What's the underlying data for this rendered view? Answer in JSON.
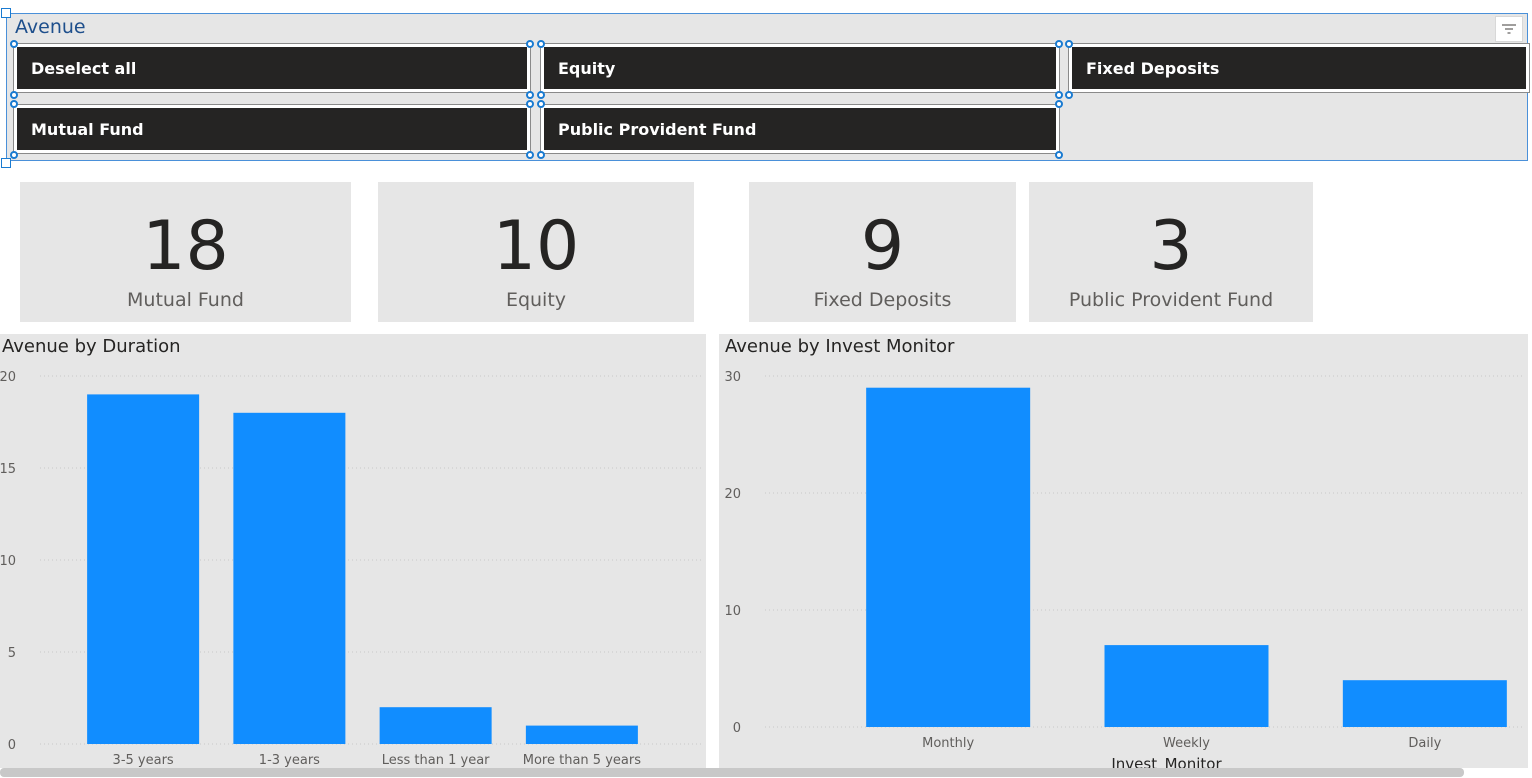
{
  "slicer": {
    "title": "Avenue",
    "filter_icon": "filter-lines-icon",
    "options": [
      {
        "label": "Deselect all"
      },
      {
        "label": "Equity"
      },
      {
        "label": "Fixed Deposits"
      },
      {
        "label": "Mutual Fund"
      },
      {
        "label": "Public Provident Fund"
      }
    ]
  },
  "cards": [
    {
      "value": "18",
      "label": "Mutual Fund"
    },
    {
      "value": "10",
      "label": "Equity"
    },
    {
      "value": "9",
      "label": "Fixed Deposits"
    },
    {
      "value": "3",
      "label": "Public Provident Fund"
    }
  ],
  "colors": {
    "bar": "#118dff",
    "panel": "#e6e6e6",
    "chip": "#252423",
    "selection": "#1a7bd1"
  },
  "chart_data": [
    {
      "type": "bar",
      "title": "Avenue by Duration",
      "categories": [
        "3-5 years",
        "1-3 years",
        "Less than 1 year",
        "More than 5 years"
      ],
      "values": [
        19,
        18,
        2,
        1
      ],
      "yticks": [
        "0",
        "5",
        "10",
        "15",
        "20"
      ],
      "ylim": [
        0,
        20
      ],
      "xlabel": "",
      "ylabel": "",
      "grid": true
    },
    {
      "type": "bar",
      "title": "Avenue by Invest Monitor",
      "categories": [
        "Monthly",
        "Weekly",
        "Daily"
      ],
      "values": [
        29,
        7,
        4
      ],
      "yticks": [
        "0",
        "10",
        "20",
        "30"
      ],
      "ylim": [
        0,
        30
      ],
      "xlabel": "Invest_Monitor",
      "ylabel": "",
      "grid": true
    }
  ]
}
